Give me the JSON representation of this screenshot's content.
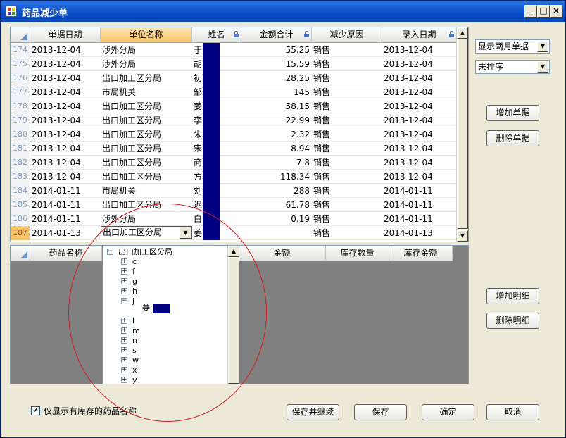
{
  "window": {
    "title": "药品减少单",
    "min_label": "_",
    "max_label": "□",
    "close_label": "×"
  },
  "top_grid": {
    "headers": [
      "单据日期",
      "单位名称",
      "姓名",
      "金额合计",
      "减少原因",
      "录入日期"
    ],
    "rows": [
      {
        "n": "174",
        "date": "2013-12-04",
        "unit": "涉外分局",
        "name": "于",
        "amount": "55.25",
        "reason": "销售",
        "entry": "2013-12-04"
      },
      {
        "n": "175",
        "date": "2013-12-04",
        "unit": "涉外分局",
        "name": "胡",
        "amount": "15.59",
        "reason": "销售",
        "entry": "2013-12-04"
      },
      {
        "n": "176",
        "date": "2013-12-04",
        "unit": "出口加工区分局",
        "name": "初",
        "amount": "28.25",
        "reason": "销售",
        "entry": "2013-12-04"
      },
      {
        "n": "177",
        "date": "2013-12-04",
        "unit": "市局机关",
        "name": "邹",
        "amount": "145",
        "reason": "销售",
        "entry": "2013-12-04"
      },
      {
        "n": "178",
        "date": "2013-12-04",
        "unit": "出口加工区分局",
        "name": "姜",
        "amount": "58.15",
        "reason": "销售",
        "entry": "2013-12-04"
      },
      {
        "n": "179",
        "date": "2013-12-04",
        "unit": "出口加工区分局",
        "name": "李",
        "amount": "22.99",
        "reason": "销售",
        "entry": "2013-12-04"
      },
      {
        "n": "180",
        "date": "2013-12-04",
        "unit": "出口加工区分局",
        "name": "朱",
        "amount": "2.32",
        "reason": "销售",
        "entry": "2013-12-04"
      },
      {
        "n": "181",
        "date": "2013-12-04",
        "unit": "出口加工区分局",
        "name": "宋",
        "amount": "8.94",
        "reason": "销售",
        "entry": "2013-12-04"
      },
      {
        "n": "182",
        "date": "2013-12-04",
        "unit": "出口加工区分局",
        "name": "商",
        "amount": "7.8",
        "reason": "销售",
        "entry": "2013-12-04"
      },
      {
        "n": "183",
        "date": "2013-12-04",
        "unit": "出口加工区分局",
        "name": "方",
        "amount": "118.34",
        "reason": "销售",
        "entry": "2013-12-04"
      },
      {
        "n": "184",
        "date": "2014-01-11",
        "unit": "市局机关",
        "name": "刘",
        "amount": "288",
        "reason": "销售",
        "entry": "2014-01-11"
      },
      {
        "n": "185",
        "date": "2014-01-11",
        "unit": "出口加工区分局",
        "name": "迟",
        "amount": "61.78",
        "reason": "销售",
        "entry": "2014-01-11"
      },
      {
        "n": "186",
        "date": "2014-01-11",
        "unit": "涉外分局",
        "name": "白",
        "amount": "0.19",
        "reason": "销售",
        "entry": "2014-01-11"
      },
      {
        "n": "187",
        "date": "2014-01-13",
        "unit": "出口加工区分局",
        "name": "姜",
        "amount": "",
        "reason": "销售",
        "entry": "2014-01-13"
      }
    ]
  },
  "right_panel": {
    "filter_value": "显示两月单据",
    "sort_value": "未排序",
    "add_doc": "增加单据",
    "delete_doc": "删除单据",
    "add_detail": "增加明细",
    "delete_detail": "删除明细"
  },
  "bottom_grid": {
    "headers": [
      "药品名称",
      "金额",
      "库存数量",
      "库存金额"
    ]
  },
  "tree": {
    "root": "出口加工区分局",
    "nodes": [
      {
        "label": "c",
        "sign": "+"
      },
      {
        "label": "f",
        "sign": "+"
      },
      {
        "label": "g",
        "sign": "+"
      },
      {
        "label": "h",
        "sign": "+"
      },
      {
        "label": "j",
        "sign": "−"
      },
      {
        "label": "l",
        "sign": "+"
      },
      {
        "label": "m",
        "sign": "+"
      },
      {
        "label": "n",
        "sign": "+"
      },
      {
        "label": "s",
        "sign": "+"
      },
      {
        "label": "w",
        "sign": "+"
      },
      {
        "label": "x",
        "sign": "+"
      },
      {
        "label": "y",
        "sign": "+"
      }
    ],
    "child_of_j": "姜"
  },
  "footer": {
    "checkbox_label": "仅显示有库存的药品名称",
    "save_continue": "保存并继续",
    "save": "保存",
    "ok": "确定",
    "cancel": "取消"
  }
}
